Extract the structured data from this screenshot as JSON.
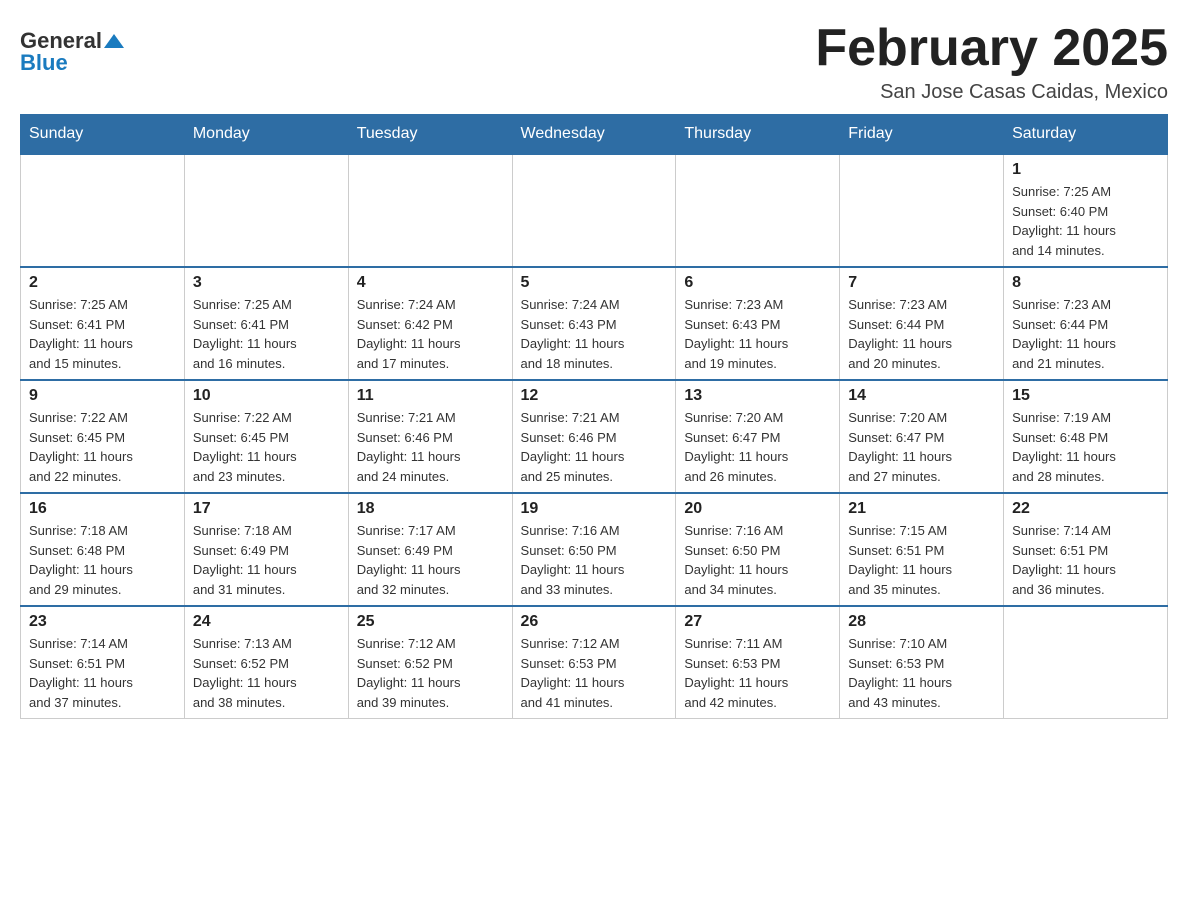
{
  "header": {
    "logo": {
      "general": "General",
      "blue": "Blue",
      "triangle": "▲"
    },
    "title": "February 2025",
    "location": "San Jose Casas Caidas, Mexico"
  },
  "weekdays": [
    "Sunday",
    "Monday",
    "Tuesday",
    "Wednesday",
    "Thursday",
    "Friday",
    "Saturday"
  ],
  "weeks": [
    [
      {
        "day": "",
        "info": ""
      },
      {
        "day": "",
        "info": ""
      },
      {
        "day": "",
        "info": ""
      },
      {
        "day": "",
        "info": ""
      },
      {
        "day": "",
        "info": ""
      },
      {
        "day": "",
        "info": ""
      },
      {
        "day": "1",
        "info": "Sunrise: 7:25 AM\nSunset: 6:40 PM\nDaylight: 11 hours\nand 14 minutes."
      }
    ],
    [
      {
        "day": "2",
        "info": "Sunrise: 7:25 AM\nSunset: 6:41 PM\nDaylight: 11 hours\nand 15 minutes."
      },
      {
        "day": "3",
        "info": "Sunrise: 7:25 AM\nSunset: 6:41 PM\nDaylight: 11 hours\nand 16 minutes."
      },
      {
        "day": "4",
        "info": "Sunrise: 7:24 AM\nSunset: 6:42 PM\nDaylight: 11 hours\nand 17 minutes."
      },
      {
        "day": "5",
        "info": "Sunrise: 7:24 AM\nSunset: 6:43 PM\nDaylight: 11 hours\nand 18 minutes."
      },
      {
        "day": "6",
        "info": "Sunrise: 7:23 AM\nSunset: 6:43 PM\nDaylight: 11 hours\nand 19 minutes."
      },
      {
        "day": "7",
        "info": "Sunrise: 7:23 AM\nSunset: 6:44 PM\nDaylight: 11 hours\nand 20 minutes."
      },
      {
        "day": "8",
        "info": "Sunrise: 7:23 AM\nSunset: 6:44 PM\nDaylight: 11 hours\nand 21 minutes."
      }
    ],
    [
      {
        "day": "9",
        "info": "Sunrise: 7:22 AM\nSunset: 6:45 PM\nDaylight: 11 hours\nand 22 minutes."
      },
      {
        "day": "10",
        "info": "Sunrise: 7:22 AM\nSunset: 6:45 PM\nDaylight: 11 hours\nand 23 minutes."
      },
      {
        "day": "11",
        "info": "Sunrise: 7:21 AM\nSunset: 6:46 PM\nDaylight: 11 hours\nand 24 minutes."
      },
      {
        "day": "12",
        "info": "Sunrise: 7:21 AM\nSunset: 6:46 PM\nDaylight: 11 hours\nand 25 minutes."
      },
      {
        "day": "13",
        "info": "Sunrise: 7:20 AM\nSunset: 6:47 PM\nDaylight: 11 hours\nand 26 minutes."
      },
      {
        "day": "14",
        "info": "Sunrise: 7:20 AM\nSunset: 6:47 PM\nDaylight: 11 hours\nand 27 minutes."
      },
      {
        "day": "15",
        "info": "Sunrise: 7:19 AM\nSunset: 6:48 PM\nDaylight: 11 hours\nand 28 minutes."
      }
    ],
    [
      {
        "day": "16",
        "info": "Sunrise: 7:18 AM\nSunset: 6:48 PM\nDaylight: 11 hours\nand 29 minutes."
      },
      {
        "day": "17",
        "info": "Sunrise: 7:18 AM\nSunset: 6:49 PM\nDaylight: 11 hours\nand 31 minutes."
      },
      {
        "day": "18",
        "info": "Sunrise: 7:17 AM\nSunset: 6:49 PM\nDaylight: 11 hours\nand 32 minutes."
      },
      {
        "day": "19",
        "info": "Sunrise: 7:16 AM\nSunset: 6:50 PM\nDaylight: 11 hours\nand 33 minutes."
      },
      {
        "day": "20",
        "info": "Sunrise: 7:16 AM\nSunset: 6:50 PM\nDaylight: 11 hours\nand 34 minutes."
      },
      {
        "day": "21",
        "info": "Sunrise: 7:15 AM\nSunset: 6:51 PM\nDaylight: 11 hours\nand 35 minutes."
      },
      {
        "day": "22",
        "info": "Sunrise: 7:14 AM\nSunset: 6:51 PM\nDaylight: 11 hours\nand 36 minutes."
      }
    ],
    [
      {
        "day": "23",
        "info": "Sunrise: 7:14 AM\nSunset: 6:51 PM\nDaylight: 11 hours\nand 37 minutes."
      },
      {
        "day": "24",
        "info": "Sunrise: 7:13 AM\nSunset: 6:52 PM\nDaylight: 11 hours\nand 38 minutes."
      },
      {
        "day": "25",
        "info": "Sunrise: 7:12 AM\nSunset: 6:52 PM\nDaylight: 11 hours\nand 39 minutes."
      },
      {
        "day": "26",
        "info": "Sunrise: 7:12 AM\nSunset: 6:53 PM\nDaylight: 11 hours\nand 41 minutes."
      },
      {
        "day": "27",
        "info": "Sunrise: 7:11 AM\nSunset: 6:53 PM\nDaylight: 11 hours\nand 42 minutes."
      },
      {
        "day": "28",
        "info": "Sunrise: 7:10 AM\nSunset: 6:53 PM\nDaylight: 11 hours\nand 43 minutes."
      },
      {
        "day": "",
        "info": ""
      }
    ]
  ]
}
